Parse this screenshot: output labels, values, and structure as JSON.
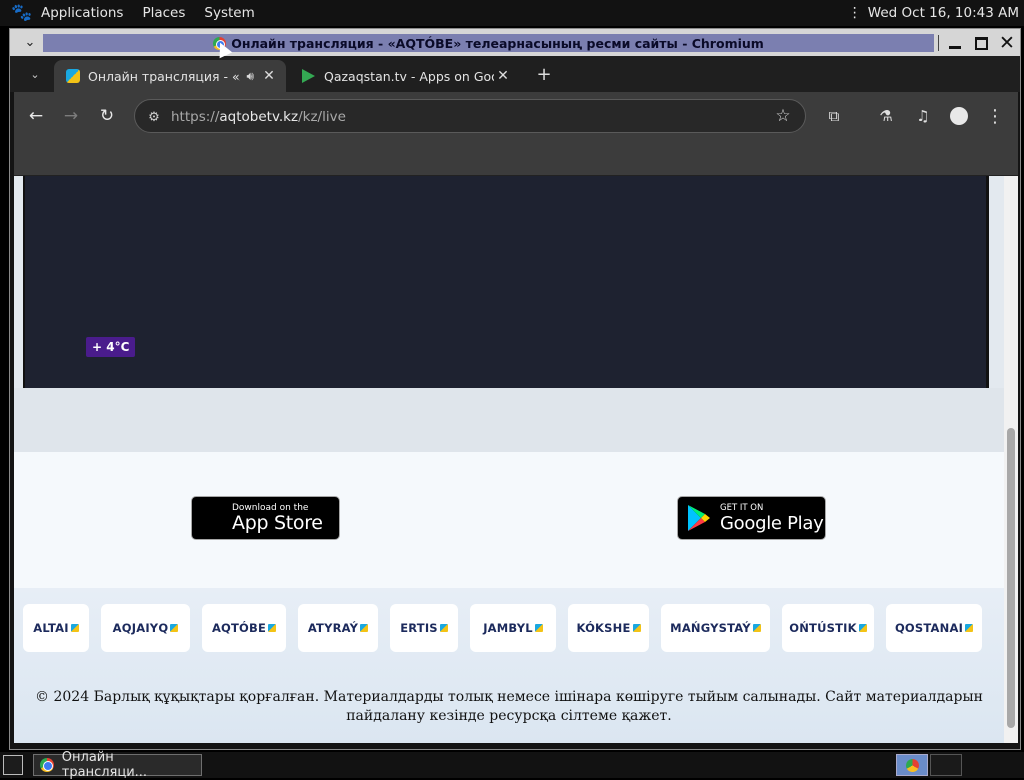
{
  "top_panel": {
    "menus": [
      "Applications",
      "Places",
      "System"
    ],
    "clock": "Wed Oct 16, 10:43 AM"
  },
  "window": {
    "title": "Онлайн трансляция - «AQTÓBE» телеарнасының ресми сайты - Chromium"
  },
  "tabs": [
    {
      "label": "Онлайн трансляция - «AQTÓBE» телеарнасының ресми сайты",
      "active": true,
      "audio": true
    },
    {
      "label": "Qazaqstan.tv - Apps on Google Play",
      "active": false
    }
  ],
  "address_bar": {
    "scheme": "https://",
    "host": "aqtobetv.kz",
    "path": "/kz/live"
  },
  "page": {
    "temperature_badge": "+ 4°C",
    "app_store": {
      "small": "Download on the",
      "big": "App Store"
    },
    "google_play": {
      "small": "GET IT ON",
      "big": "Google Play"
    },
    "channels": [
      "ALTAI",
      "AQJAIYQ",
      "AQTÓBE",
      "ATYRAÝ",
      "ERTIS",
      "JAMBYL",
      "KÓKSHE",
      "MAŃGYSTAÝ",
      "OŃTÚSTIK",
      "QOSTANAI"
    ],
    "copyright": "© 2024 Барлық құқықтары қорғалған. Материалдарды толық немесе ішінара көшіруге тыйым салынады. Сайт материалдарын пайдалану кезінде ресурсқа сілтеме қажет."
  },
  "taskbar": {
    "app_label": "Онлайн трансляци..."
  },
  "icons": {
    "gnome_foot": "gnome-foot-icon",
    "back": "arrow-left-icon",
    "forward": "arrow-right-icon",
    "reload": "reload-icon",
    "site_info": "tune-icon",
    "bookmark": "star-icon",
    "extensions": "puzzle-icon",
    "labs": "flask-icon",
    "media": "media-control-icon",
    "profile": "person-icon",
    "menu": "kebab-icon"
  }
}
